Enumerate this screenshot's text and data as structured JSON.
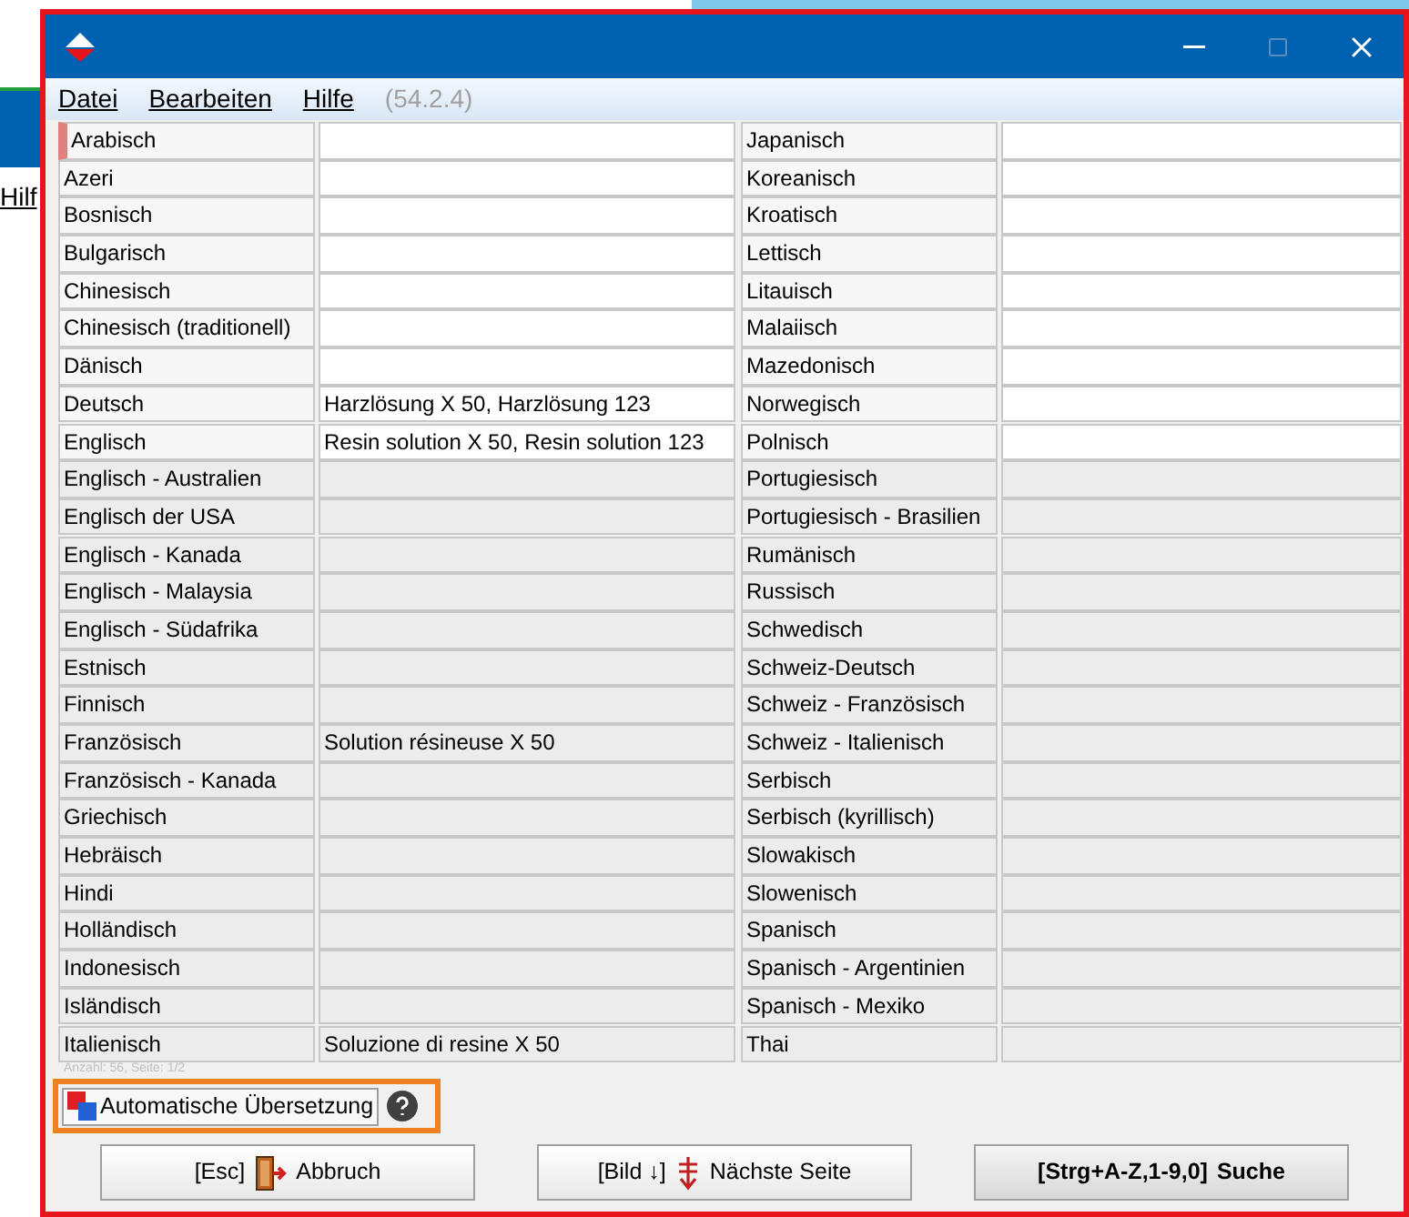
{
  "background_window": {
    "menu_item": "Hilf"
  },
  "menu": [
    "Datei",
    "Bearbeiten",
    "Hilfe"
  ],
  "version": "(54.2.4)",
  "left_rows": [
    {
      "language": "Arabisch",
      "selected": true
    },
    {
      "language": "Azeri",
      "selected": false
    },
    {
      "language": "Bosnisch",
      "selected": false
    },
    {
      "language": "Bulgarisch",
      "selected": false
    },
    {
      "language": "Chinesisch",
      "selected": false
    },
    {
      "language": "Chinesisch (traditionell)",
      "selected": false
    },
    {
      "language": "Dänisch",
      "selected": false
    },
    {
      "language": "Deutsch",
      "translation": "Harzlösung X 50, Harzlösung 123",
      "selected": false
    },
    {
      "language": "Englisch",
      "translation": "Resin solution X 50, Resin solution 123",
      "selected": false
    },
    {
      "language": "Englisch - Australien",
      "selected": false
    },
    {
      "language": "Englisch der USA",
      "selected": false
    },
    {
      "language": "Englisch - Kanada",
      "selected": false
    },
    {
      "language": "Englisch - Malaysia",
      "selected": false
    },
    {
      "language": "Englisch - Südafrika",
      "selected": false
    },
    {
      "language": "Estnisch",
      "selected": false
    },
    {
      "language": "Finnisch",
      "selected": false
    },
    {
      "language": "Französisch",
      "translation": "Solution résineuse X 50",
      "selected": false
    },
    {
      "language": "Französisch - Kanada",
      "selected": false
    },
    {
      "language": "Griechisch",
      "selected": false
    },
    {
      "language": "Hebräisch",
      "selected": false
    },
    {
      "language": "Hindi",
      "selected": false
    },
    {
      "language": "Holländisch",
      "selected": false
    },
    {
      "language": "Indonesisch",
      "selected": false
    },
    {
      "language": "Isländisch",
      "selected": false
    },
    {
      "language": "Italienisch",
      "translation": "Soluzione di resine X 50",
      "selected": false
    }
  ],
  "right_rows": [
    {
      "language": "Japanisch",
      "selected": false
    },
    {
      "language": "Koreanisch",
      "selected": false
    },
    {
      "language": "Kroatisch",
      "selected": false
    },
    {
      "language": "Lettisch",
      "selected": false
    },
    {
      "language": "Litauisch",
      "selected": false
    },
    {
      "language": "Malaiisch",
      "selected": false
    },
    {
      "language": "Mazedonisch",
      "selected": false
    },
    {
      "language": "Norwegisch",
      "selected": false
    },
    {
      "language": "Polnisch",
      "selected": false
    },
    {
      "language": "Portugiesisch",
      "selected": false
    },
    {
      "language": "Portugiesisch - Brasilien",
      "selected": false
    },
    {
      "language": "Rumänisch",
      "selected": false
    },
    {
      "language": "Russisch",
      "selected": false
    },
    {
      "language": "Schwedisch",
      "selected": false
    },
    {
      "language": "Schweiz-Deutsch",
      "selected": false
    },
    {
      "language": "Schweiz - Französisch",
      "selected": false
    },
    {
      "language": "Schweiz - Italienisch",
      "selected": false
    },
    {
      "language": "Serbisch",
      "selected": false
    },
    {
      "language": "Serbisch (kyrillisch)",
      "selected": false
    },
    {
      "language": "Slowakisch",
      "selected": false
    },
    {
      "language": "Slowenisch",
      "selected": false
    },
    {
      "language": "Spanisch",
      "selected": false
    },
    {
      "language": "Spanisch - Argentinien",
      "selected": false
    },
    {
      "language": "Spanisch - Mexiko",
      "selected": false
    },
    {
      "language": "Thai",
      "selected": false
    }
  ],
  "count_text": "Anzahl: 56, Seite: 1/2",
  "auto_translate_button": "Automatische Übersetzung",
  "buttons": [
    {
      "key": "[Esc]",
      "label": "Abbruch",
      "kind": "cancel"
    },
    {
      "key": "[Bild ↓]",
      "label": "Nächste Seite",
      "kind": "next"
    },
    {
      "key": "[Strg+A-Z,1-9,0]",
      "label": "Suche",
      "kind": "search"
    }
  ]
}
